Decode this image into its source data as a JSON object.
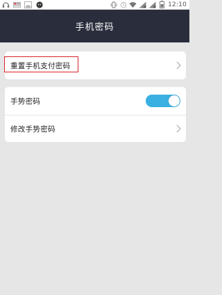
{
  "status_bar": {
    "time": "12:10",
    "battery_percent": "",
    "icons": [
      "headset-icon",
      "gallery-icon",
      "image-icon",
      "wechat-icon",
      "vibrate-icon",
      "alarm-icon",
      "wifi-icon",
      "signal-1-icon",
      "signal-2-icon",
      "battery-icon"
    ]
  },
  "header": {
    "title": "手机密码"
  },
  "sections": {
    "reset_pay": {
      "label": "重置手机支付密码"
    },
    "gesture": {
      "label": "手势密码",
      "enabled": true
    },
    "change_gesture": {
      "label": "修改手势密码"
    }
  },
  "colors": {
    "title_bar_bg": "#2a2d3c",
    "toggle_on": "#3ab0e2",
    "highlight_border": "#d8222a",
    "page_bg": "#e6e6e6"
  }
}
